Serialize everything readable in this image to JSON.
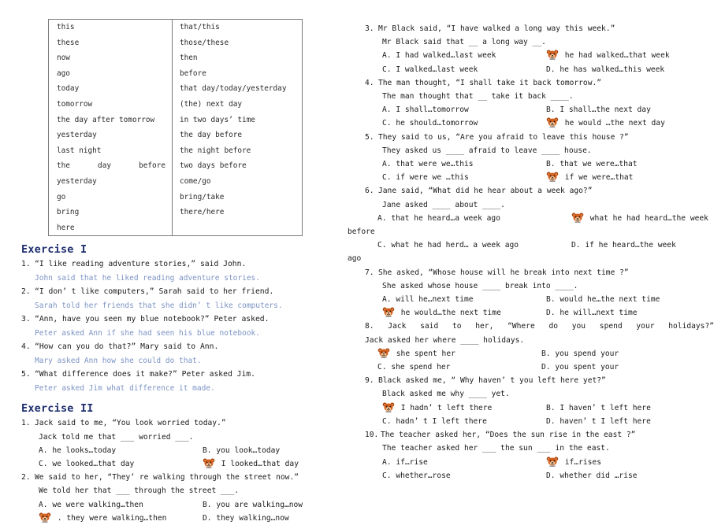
{
  "table": {
    "rows": [
      [
        "this",
        "that/this"
      ],
      [
        "these",
        "those/these"
      ],
      [
        "now",
        "then"
      ],
      [
        "ago",
        "before"
      ],
      [
        "today",
        "that day/today/yesterday"
      ],
      [
        "tomorrow",
        "(the) next day"
      ],
      [
        "the day after tomorrow",
        "in two days’ time"
      ],
      [
        "yesterday",
        "the day before"
      ],
      [
        "last night",
        "the night before"
      ],
      [
        "the day before",
        "two days before"
      ],
      [
        "yesterday",
        "come/go"
      ],
      [
        "go",
        "bring/take"
      ],
      [
        "bring",
        "there/here"
      ],
      [
        "here",
        ""
      ]
    ]
  },
  "exercise1": {
    "heading": "Exercise I",
    "items": [
      {
        "num": "1.",
        "question": "“I like reading adventure stories,”  said John.",
        "answer": "John said that he liked reading adventure stories."
      },
      {
        "num": "2.",
        "question": "“I don’ t like computers,”  Sarah said to her friend.",
        "answer": "Sarah told her friends that she didn’ t like computers."
      },
      {
        "num": "3.",
        "question": "“Ann, have you seen my blue notebook?”  Peter asked.",
        "answer": "Peter asked Ann if she had seen his blue notebook."
      },
      {
        "num": "4.",
        "question": "“How can you do that?”  Mary said to Ann.",
        "answer": "Mary asked Ann how she could do that."
      },
      {
        "num": "5.",
        "question": "“What difference does it make?”  Peter asked Jim.",
        "answer": "Peter asked Jim what difference it made."
      }
    ]
  },
  "exercise2": {
    "heading": "Exercise II",
    "items": [
      {
        "num": "1.",
        "stem": "Jack said to me,  “You look worried today.”",
        "sub": "Jack told me that ___ worried ___.",
        "options": [
          {
            "label": "A.",
            "text": "he looks…today",
            "correct": false
          },
          {
            "label": "B.",
            "text": "you look…today",
            "correct": false
          },
          {
            "label": "C.",
            "text": "we looked…that day",
            "correct": false
          },
          {
            "label": "D.",
            "text": "I looked…that day",
            "correct": true
          }
        ]
      },
      {
        "num": "2.",
        "stem": "We said to her,  “They’ re walking through the street now.”",
        "sub": "We told her that ___ through the street ___.",
        "options": [
          {
            "label": "A.",
            "text": "we were walking…then",
            "correct": false
          },
          {
            "label": "B.",
            "text": "you are walking…now",
            "correct": false
          },
          {
            "label": "C.",
            "text": ". they were walking…then",
            "correct": true
          },
          {
            "label": "D.",
            "text": "they walking…now",
            "correct": false
          }
        ]
      }
    ]
  },
  "right_column": {
    "items": [
      {
        "num": "3.",
        "stem": "Mr Black said,  “I have walked a long way this week.”",
        "sub": "Mr Black said that __ a long way __.",
        "options": [
          {
            "label": "A.",
            "text": "I had walked…last week",
            "correct": false
          },
          {
            "label": "B.",
            "text": "he had walked…that week",
            "correct": true
          },
          {
            "label": "C.",
            "text": "I walked…last week",
            "correct": false
          },
          {
            "label": "D.",
            "text": "he has walked…this week",
            "correct": false
          }
        ]
      },
      {
        "num": "4.",
        "stem": "The man thought,  “I shall take it back tomorrow.”",
        "sub": "The man thought that __ take it back ____.",
        "options": [
          {
            "label": "A.",
            "text": "I shall…tomorrow",
            "correct": false
          },
          {
            "label": "B.",
            "text": "I shall…the next day",
            "correct": false
          },
          {
            "label": "C.",
            "text": "he should…tomorrow",
            "correct": false
          },
          {
            "label": "D.",
            "text": "he would …the next day",
            "correct": true
          }
        ]
      },
      {
        "num": "5.",
        "stem": "They said to us,  “Are you afraid to leave this house ?”",
        "sub": "They asked us ____ afraid to leave ____ house.",
        "options": [
          {
            "label": "A.",
            "text": "that were we…this",
            "correct": false
          },
          {
            "label": "B.",
            "text": "that we were…that",
            "correct": false
          },
          {
            "label": "C.",
            "text": "if were we …this",
            "correct": false
          },
          {
            "label": "D.",
            "text": "if we were…that",
            "correct": true
          }
        ]
      },
      {
        "num": "6.",
        "stem": "Jane said, “What did he hear about a week ago?”",
        "sub": "Jane asked ____ about ____.",
        "options": [
          {
            "label": "A.",
            "text": "that he heard…a week ago",
            "correct": false
          },
          {
            "label": "B.",
            "text": "what he had heard…the week",
            "correct": true,
            "overflow": "before"
          },
          {
            "label": "C.",
            "text": "what he had herd… a week ago",
            "correct": false
          },
          {
            "label": "D.",
            "text": "if he heard…the week",
            "correct": false,
            "overflow": "ago"
          }
        ]
      },
      {
        "num": "7.",
        "stem": "She asked,  “Whose house will he break into next time ?”",
        "sub": "She asked whose house ____ break into ____.",
        "options": [
          {
            "label": "A.",
            "text": "will he…next time",
            "correct": false
          },
          {
            "label": "B.",
            "text": "would he…the next time",
            "correct": false
          },
          {
            "label": "C.",
            "text": "he would…the next time",
            "correct": true
          },
          {
            "label": "D.",
            "text": "he will…next time",
            "correct": false
          }
        ]
      },
      {
        "num": "8.",
        "stem": "Jack said to her,  “Where do you spend your holidays?”",
        "sub": "Jack asked her where ____ holidays.",
        "options": [
          {
            "label": "A.",
            "text": "she spent her",
            "correct": true
          },
          {
            "label": "B.",
            "text": "you spend your",
            "correct": false
          },
          {
            "label": "C.",
            "text": "she spend her",
            "correct": false
          },
          {
            "label": "D.",
            "text": "you spent your",
            "correct": false
          }
        ]
      },
      {
        "num": "9.",
        "stem": "Black asked me, “ Why haven’ t you left here yet?”",
        "sub": "Black asked me why ____ yet.",
        "options": [
          {
            "label": "A.",
            "text": "I hadn’ t left there",
            "correct": true
          },
          {
            "label": "B.",
            "text": "I haven’ t left here",
            "correct": false
          },
          {
            "label": "C.",
            "text": "hadn’ t I left there",
            "correct": false
          },
          {
            "label": "D.",
            "text": "haven’ t I left here",
            "correct": false
          }
        ]
      },
      {
        "num": "10.",
        "stem": "The teacher asked her,  “Does the sun rise in the east ?”",
        "sub": "The teacher asked her ___ the sun ___ in the east.",
        "options": [
          {
            "label": "A.",
            "text": "if…rise",
            "correct": false
          },
          {
            "label": "B.",
            "text": "if…rises",
            "correct": true
          },
          {
            "label": "C.",
            "text": "whether…rose",
            "correct": false
          },
          {
            "label": "D.",
            "text": "whether did …rise",
            "correct": false
          }
        ]
      }
    ]
  },
  "icon": {
    "name": "bear-head-icon",
    "color": "#d4601e",
    "color_dark": "#a8430f",
    "color_light": "#e8924c"
  }
}
